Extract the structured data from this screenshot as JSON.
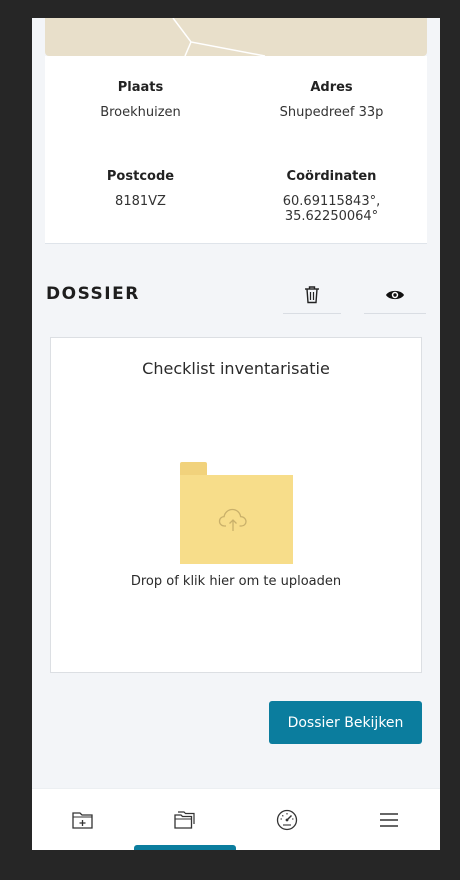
{
  "location": {
    "place_label": "Plaats",
    "place_value": "Broekhuizen",
    "address_label": "Adres",
    "address_value": "Shupedreef 33p",
    "postcode_label": "Postcode",
    "postcode_value": "8181VZ",
    "coords_label": "Coördinaten",
    "coords_value": "60.69115843°, 35.62250064°"
  },
  "dossier": {
    "title": "DOSSIER",
    "delete_icon": "trash-icon",
    "view_icon": "eye-icon",
    "upload": {
      "title": "Checklist inventarisatie",
      "hint": "Drop of klik hier om te uploaden",
      "icon": "cloud-upload-icon"
    },
    "view_button_label": "Dossier Bekijken"
  },
  "nav": {
    "items": [
      {
        "icon": "folder-add-icon",
        "active": false
      },
      {
        "icon": "folders-icon",
        "active": true
      },
      {
        "icon": "dashboard-icon",
        "active": false
      },
      {
        "icon": "menu-icon",
        "active": false
      }
    ]
  },
  "colors": {
    "accent": "#0b7d9e",
    "folder": "#f7dd8a",
    "map": "#e8dfca"
  }
}
